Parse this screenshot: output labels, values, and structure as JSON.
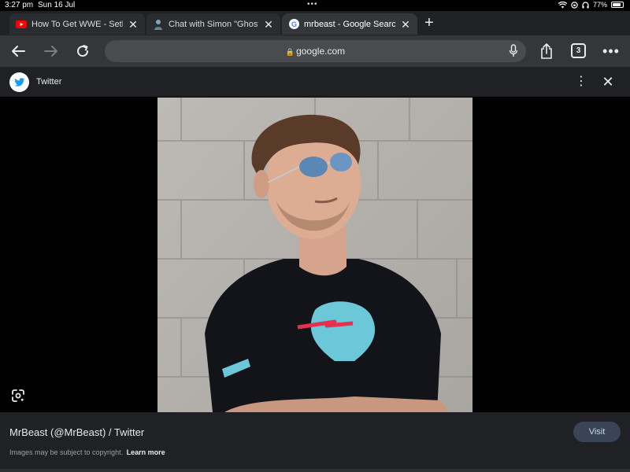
{
  "status_bar": {
    "time": "3:27 pm",
    "date": "Sun 16 Jul",
    "battery": "77%"
  },
  "tabs": [
    {
      "title": "How To Get WWE - Seth",
      "favicon": "youtube-icon",
      "active": false
    },
    {
      "title": "Chat with Simon \"Ghost\"",
      "favicon": "character-ai-icon",
      "active": false
    },
    {
      "title": "mrbeast - Google Search",
      "favicon": "google-icon",
      "active": true
    }
  ],
  "toolbar": {
    "url": "google.com",
    "tab_count": "3"
  },
  "viewer": {
    "source": "Twitter",
    "result_title": "MrBeast (@MrBeast) / Twitter",
    "visit_label": "Visit",
    "copyright_text": "Images may be subject to copyright.",
    "learn_more": "Learn more"
  },
  "colors": {
    "tab_bar": "#202124",
    "toolbar": "#35363a",
    "omnibox": "#4a4b4f",
    "visit_button": "#394457",
    "twitter_blue": "#1d9bf0"
  }
}
